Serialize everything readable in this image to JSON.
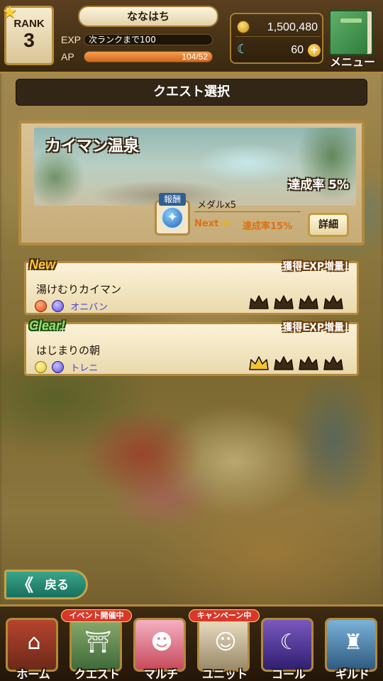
{
  "player": {
    "rank_label": "RANK",
    "rank_value": "3",
    "name": "ななはち",
    "exp_label": "EXP",
    "exp_text": "次ランクまで100",
    "exp_fill_fraction": 0.0,
    "ap_label": "AP",
    "ap_text": "104/52",
    "ap_fill_fraction": 1.0
  },
  "currency": {
    "gold": "1,500,480",
    "gems": "60",
    "plus": "+"
  },
  "menu": {
    "label": "メニュー"
  },
  "page": {
    "title": "クエスト選択"
  },
  "stage": {
    "name": "カイマン温泉",
    "completion": "達成率 5%",
    "reward_label": "報酬",
    "reward_item": "メダルx5",
    "next_label": "Next",
    "next_arrow": "➡",
    "next_condition": "達成率15%",
    "detail_button": "詳細"
  },
  "quests": [
    {
      "tag": "New",
      "exp_boost": "獲得EXP増量！",
      "title": "湯けむりカイマン",
      "element": "fire",
      "boss": "オニバン",
      "crowns_earned": 0,
      "crowns_total": 4
    },
    {
      "tag": "Clear!",
      "exp_boost": "獲得EXP増量！",
      "title": "はじまりの朝",
      "element": "light",
      "boss": "トレニ",
      "crowns_earned": 1,
      "crowns_total": 4
    }
  ],
  "back_button": {
    "icon": "《",
    "label": "戻る"
  },
  "nav": {
    "home": "ホーム",
    "quest": "クエスト",
    "quest_badge": "イベント開催中",
    "multi": "マルチ",
    "unit": "ユニット",
    "unit_badge": "キャンペーン中",
    "call": "コール",
    "guild": "ギルド"
  },
  "colors": {
    "crown_earned": "#f2c230",
    "crown_empty": "#3a2a14",
    "accent_gold": "#b48a3e"
  }
}
